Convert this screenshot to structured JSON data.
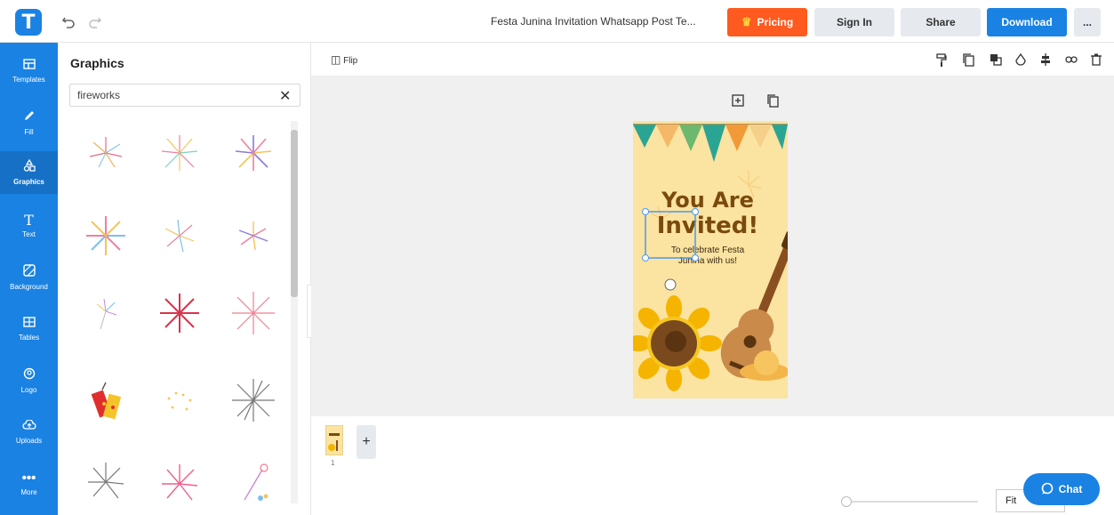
{
  "header": {
    "logo_letter": "T",
    "undo_icon": "undo-icon",
    "redo_icon": "redo-icon",
    "document_title": "Festa Junina Invitation Whatsapp Post Te...",
    "pricing_label": "Pricing",
    "signin_label": "Sign In",
    "share_label": "Share",
    "download_label": "Download",
    "more_label": "..."
  },
  "sidebar": {
    "items": [
      {
        "label": "Templates",
        "icon": "templates-icon"
      },
      {
        "label": "Fill",
        "icon": "pencil-icon"
      },
      {
        "label": "Graphics",
        "icon": "shapes-icon"
      },
      {
        "label": "Text",
        "icon": "text-icon"
      },
      {
        "label": "Background",
        "icon": "background-icon"
      },
      {
        "label": "Tables",
        "icon": "table-icon"
      },
      {
        "label": "Logo",
        "icon": "logo-icon"
      },
      {
        "label": "Uploads",
        "icon": "cloud-upload-icon"
      },
      {
        "label": "More",
        "icon": "more-icon"
      }
    ],
    "active": "Graphics"
  },
  "panel": {
    "title": "Graphics",
    "search_value": "fireworks",
    "clear_icon": "close-icon"
  },
  "toolbar": {
    "flip_label": "Flip"
  },
  "design": {
    "headline_1": "You Are",
    "headline_2": "Invited!",
    "subtext_1": "To celebrate Festa",
    "subtext_2": "Junina with us!"
  },
  "pages": {
    "page_number": "1",
    "add_label": "+"
  },
  "zoom": {
    "fit_label": "Fit"
  },
  "chat": {
    "label": "Chat"
  },
  "colors": {
    "brand_blue": "#1a82e2",
    "pricing_orange": "#ff5a1f",
    "design_bg": "#fbe3a1",
    "headline_brown": "#7a4a0c"
  }
}
